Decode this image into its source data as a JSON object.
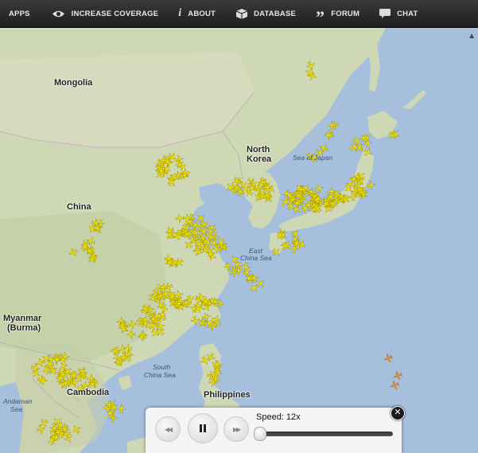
{
  "nav": {
    "items": [
      {
        "label": "APPS",
        "icon": "none"
      },
      {
        "label": "INCREASE COVERAGE",
        "icon": "eye-icon"
      },
      {
        "label": "ABOUT",
        "icon": "info-icon"
      },
      {
        "label": "DATABASE",
        "icon": "database-icon"
      },
      {
        "label": "FORUM",
        "icon": "quote-icon"
      },
      {
        "label": "CHAT",
        "icon": "chat-bubble-icon"
      }
    ]
  },
  "map": {
    "labels": {
      "mongolia": "Mongolia",
      "north_korea_1": "North",
      "north_korea_2": "Korea",
      "sea_of_japan": "Sea of Japan",
      "china": "China",
      "east_china_sea_1": "East",
      "east_china_sea_2": "China Sea",
      "myanmar_1": "Myanmar",
      "myanmar_2": "(Burma)",
      "south_china_sea_1": "South",
      "south_china_sea_2": "China Sea",
      "cambodia": "Cambodia",
      "philippines": "Philippines",
      "andaman_sea_1": "Andaman",
      "andaman_sea_2": "Sea"
    },
    "colors": {
      "land": "#cfd8b4",
      "water": "#a5bfdd",
      "plane": "#f2e600",
      "plane_highlight": "#f59a1a"
    }
  },
  "player": {
    "speed_label": "Speed: 12x",
    "speed_value": 12,
    "rewind_icon": "rewind-icon",
    "pause_icon": "pause-icon",
    "forward_icon": "fast-forward-icon",
    "close_icon": "close-icon"
  }
}
